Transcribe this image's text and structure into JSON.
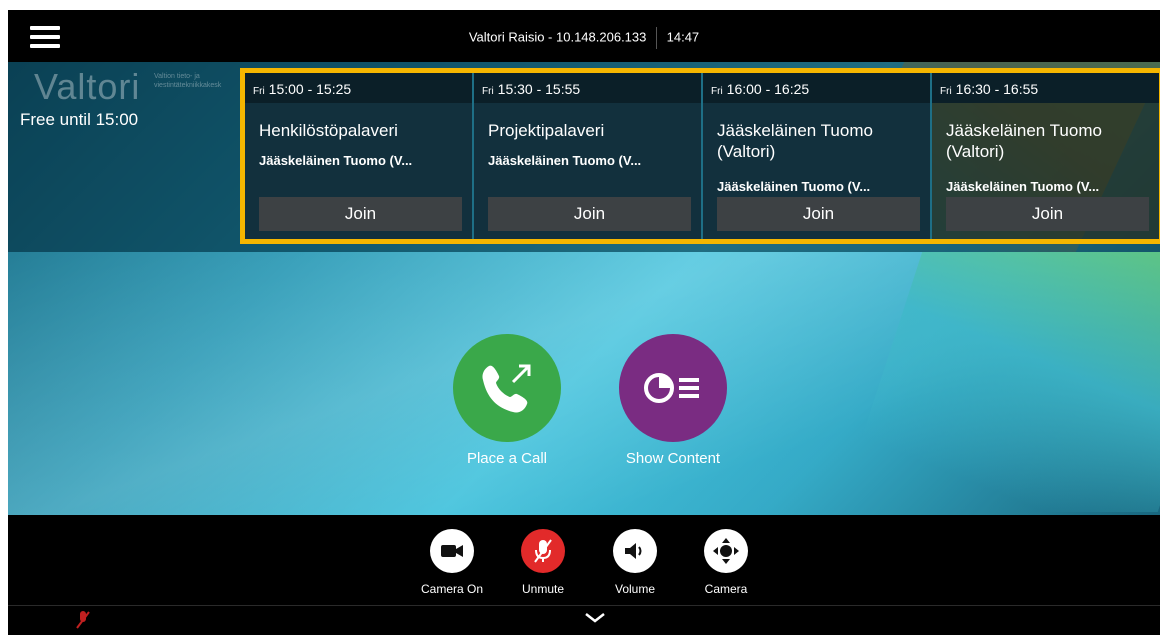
{
  "topbar": {
    "menu_icon": "hamburger-menu-icon",
    "device": "Valtori Raisio - 10.148.206.133",
    "time": "14:47"
  },
  "room": {
    "brand": "Valtori",
    "brand_sub": "Valtion tieto- ja viestintätekniikkakesk",
    "status": "Free until 15:00"
  },
  "meetings": [
    {
      "day": "Fri",
      "time": "15:00 - 15:25",
      "title": "Henkilöstöpalaveri",
      "organizer": "Jääskeläinen Tuomo (V...",
      "join": "Join"
    },
    {
      "day": "Fri",
      "time": "15:30 - 15:55",
      "title": "Projektipalaveri",
      "organizer": "Jääskeläinen Tuomo (V...",
      "join": "Join"
    },
    {
      "day": "Fri",
      "time": "16:00 - 16:25",
      "title": "Jääskeläinen Tuomo (Valtori)",
      "organizer": "Jääskeläinen Tuomo (V...",
      "join": "Join"
    },
    {
      "day": "Fri",
      "time": "16:30 - 16:55",
      "title": "Jääskeläinen Tuomo (Valtori)",
      "organizer": "Jääskeläinen Tuomo (V...",
      "join": "Join"
    }
  ],
  "actions": {
    "place_call": {
      "label": "Place a Call",
      "icon": "phone-outgoing-icon",
      "color": "#3aa84a"
    },
    "show_content": {
      "label": "Show Content",
      "icon": "share-content-icon",
      "color": "#7a2c82"
    }
  },
  "toolbar": {
    "camera_on": {
      "label": "Camera On",
      "icon": "camera-icon"
    },
    "unmute": {
      "label": "Unmute",
      "icon": "microphone-muted-icon",
      "color": "#e22a2a"
    },
    "volume": {
      "label": "Volume",
      "icon": "speaker-icon"
    },
    "camera": {
      "label": "Camera",
      "icon": "camera-control-icon"
    }
  },
  "colors": {
    "highlight": "#f5b600",
    "accent": "#1c92b0"
  }
}
